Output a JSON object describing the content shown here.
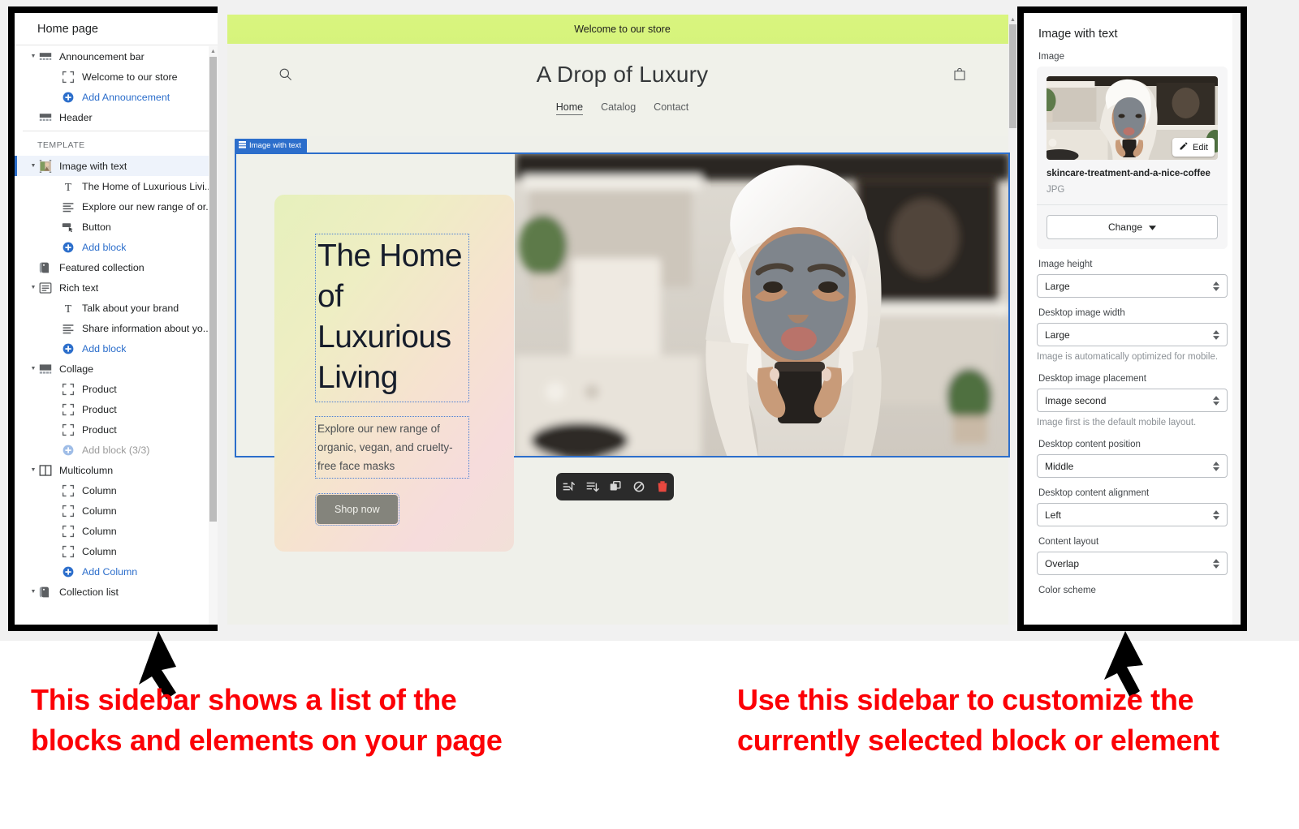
{
  "left_sidebar": {
    "title": "Home page",
    "section_label": "TEMPLATE",
    "tree": [
      {
        "label": "Announcement bar",
        "icon": "announcement-bar-icon",
        "indent": 0,
        "caret": true,
        "kind": "normal"
      },
      {
        "label": "Welcome to our store",
        "icon": "block-icon",
        "indent": 1,
        "caret": false,
        "kind": "normal"
      },
      {
        "label": "Add Announcement",
        "icon": "plus-circle-icon",
        "indent": 1,
        "caret": false,
        "kind": "link"
      },
      {
        "label": "Header",
        "icon": "header-icon",
        "indent": 0,
        "caret": false,
        "kind": "normal"
      },
      {
        "label": "Image with text",
        "icon": "image-with-text-icon",
        "indent": 0,
        "caret": true,
        "kind": "selected"
      },
      {
        "label": "The Home of Luxurious Livi...",
        "icon": "text-heading-icon",
        "indent": 1,
        "caret": false,
        "kind": "normal"
      },
      {
        "label": "Explore our new range of or...",
        "icon": "text-paragraph-icon",
        "indent": 1,
        "caret": false,
        "kind": "normal"
      },
      {
        "label": "Button",
        "icon": "button-icon",
        "indent": 1,
        "caret": false,
        "kind": "normal"
      },
      {
        "label": "Add block",
        "icon": "plus-circle-icon",
        "indent": 1,
        "caret": false,
        "kind": "link"
      },
      {
        "label": "Featured collection",
        "icon": "collection-icon",
        "indent": 0,
        "caret": false,
        "kind": "normal"
      },
      {
        "label": "Rich text",
        "icon": "rich-text-icon",
        "indent": 0,
        "caret": true,
        "kind": "normal"
      },
      {
        "label": "Talk about your brand",
        "icon": "text-heading-icon",
        "indent": 1,
        "caret": false,
        "kind": "normal"
      },
      {
        "label": "Share information about yo...",
        "icon": "text-paragraph-icon",
        "indent": 1,
        "caret": false,
        "kind": "normal"
      },
      {
        "label": "Add block",
        "icon": "plus-circle-icon",
        "indent": 1,
        "caret": false,
        "kind": "link"
      },
      {
        "label": "Collage",
        "icon": "collage-icon",
        "indent": 0,
        "caret": true,
        "kind": "normal"
      },
      {
        "label": "Product",
        "icon": "block-icon",
        "indent": 1,
        "caret": false,
        "kind": "normal"
      },
      {
        "label": "Product",
        "icon": "block-icon",
        "indent": 1,
        "caret": false,
        "kind": "normal"
      },
      {
        "label": "Product",
        "icon": "block-icon",
        "indent": 1,
        "caret": false,
        "kind": "normal"
      },
      {
        "label": "Add block (3/3)",
        "icon": "plus-circle-icon",
        "indent": 1,
        "caret": false,
        "kind": "disabled"
      },
      {
        "label": "Multicolumn",
        "icon": "multicolumn-icon",
        "indent": 0,
        "caret": true,
        "kind": "normal"
      },
      {
        "label": "Column",
        "icon": "block-icon",
        "indent": 1,
        "caret": false,
        "kind": "normal"
      },
      {
        "label": "Column",
        "icon": "block-icon",
        "indent": 1,
        "caret": false,
        "kind": "normal"
      },
      {
        "label": "Column",
        "icon": "block-icon",
        "indent": 1,
        "caret": false,
        "kind": "normal"
      },
      {
        "label": "Column",
        "icon": "block-icon",
        "indent": 1,
        "caret": false,
        "kind": "normal"
      },
      {
        "label": "Add Column",
        "icon": "plus-circle-icon",
        "indent": 1,
        "caret": false,
        "kind": "link"
      },
      {
        "label": "Collection list",
        "icon": "collection-icon",
        "indent": 0,
        "caret": true,
        "kind": "normal"
      }
    ]
  },
  "preview": {
    "announcement": "Welcome to our store",
    "store_title": "A Drop of Luxury",
    "nav": [
      "Home",
      "Catalog",
      "Contact"
    ],
    "nav_active": "Home",
    "search_icon": "search-icon",
    "cart_icon": "shopping-bag-icon",
    "section_badge": "Image with text",
    "hero": {
      "heading": "The Home of Luxurious Living",
      "subtext": "Explore our new range of organic, vegan, and cruelty-free face masks",
      "button": "Shop now"
    },
    "toolbar": [
      {
        "name": "move-up-icon",
        "title": "Move up"
      },
      {
        "name": "move-down-icon",
        "title": "Move down"
      },
      {
        "name": "duplicate-icon",
        "title": "Duplicate"
      },
      {
        "name": "hide-icon",
        "title": "Hide"
      },
      {
        "name": "delete-icon",
        "title": "Delete"
      }
    ]
  },
  "right_sidebar": {
    "title": "Image with text",
    "image_label": "Image",
    "image_name": "skincare-treatment-and-a-nice-coffee",
    "image_type": "JPG",
    "edit_label": "Edit",
    "change_label": "Change",
    "fields": [
      {
        "label": "Image height",
        "value": "Large",
        "helper": ""
      },
      {
        "label": "Desktop image width",
        "value": "Large",
        "helper": "Image is automatically optimized for mobile."
      },
      {
        "label": "Desktop image placement",
        "value": "Image second",
        "helper": "Image first is the default mobile layout."
      },
      {
        "label": "Desktop content position",
        "value": "Middle",
        "helper": ""
      },
      {
        "label": "Desktop content alignment",
        "value": "Left",
        "helper": ""
      },
      {
        "label": "Content layout",
        "value": "Overlap",
        "helper": ""
      }
    ],
    "last_label": "Color scheme"
  },
  "annotations": {
    "left": "This sidebar shows a list of the blocks and elements on your page",
    "right": "Use this sidebar to customize the currently selected block or element",
    "color": "#fc0006"
  }
}
